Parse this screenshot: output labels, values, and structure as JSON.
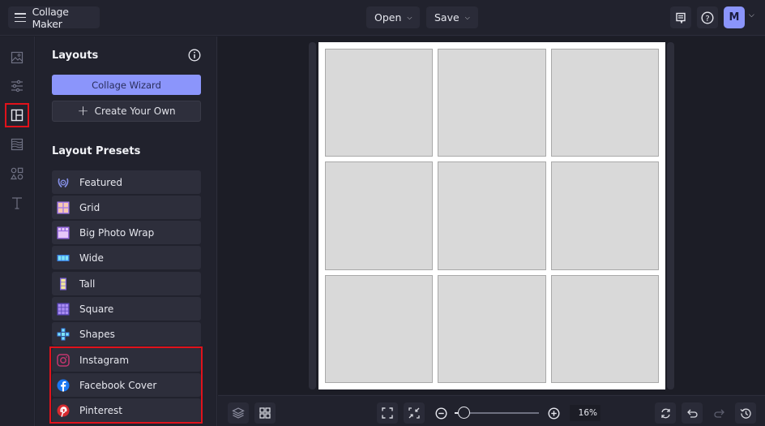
{
  "header": {
    "app_title": "Collage Maker",
    "menu_icon": "hamburger-icon",
    "open_label": "Open",
    "save_label": "Save",
    "feedback_icon": "feedback-icon",
    "help_icon": "help-icon",
    "avatar_initial": "M",
    "avatar_color": "#8b95fb"
  },
  "rail": {
    "items": [
      {
        "name": "photos",
        "icon": "image-icon",
        "active": false
      },
      {
        "name": "adjustments",
        "icon": "sliders-icon",
        "active": false
      },
      {
        "name": "layouts",
        "icon": "layout-icon",
        "active": true
      },
      {
        "name": "backgrounds",
        "icon": "texture-icon",
        "active": false
      },
      {
        "name": "graphics",
        "icon": "shapes-icon",
        "active": false
      },
      {
        "name": "text",
        "icon": "text-icon",
        "active": false
      }
    ]
  },
  "panel": {
    "title": "Layouts",
    "wizard_label": "Collage Wizard",
    "create_label": "Create Your Own",
    "presets_title": "Layout Presets",
    "presets": [
      {
        "label": "Featured",
        "icon": "laurel-icon"
      },
      {
        "label": "Grid",
        "icon": "grid-icon"
      },
      {
        "label": "Big Photo Wrap",
        "icon": "big-photo-wrap-icon"
      },
      {
        "label": "Wide",
        "icon": "wide-icon"
      },
      {
        "label": "Tall",
        "icon": "tall-icon"
      },
      {
        "label": "Square",
        "icon": "square-grid-icon"
      },
      {
        "label": "Shapes",
        "icon": "plus-shape-icon"
      },
      {
        "label": "Instagram",
        "icon": "instagram-icon"
      },
      {
        "label": "Facebook Cover",
        "icon": "facebook-icon"
      },
      {
        "label": "Pinterest",
        "icon": "pinterest-icon"
      }
    ]
  },
  "canvas": {
    "rows": 3,
    "cols": 3
  },
  "bottom": {
    "zoom_value": "16%",
    "zoom_fraction": 0.05
  },
  "colors": {
    "accent": "#8b95fb",
    "highlight": "#e0121b"
  }
}
